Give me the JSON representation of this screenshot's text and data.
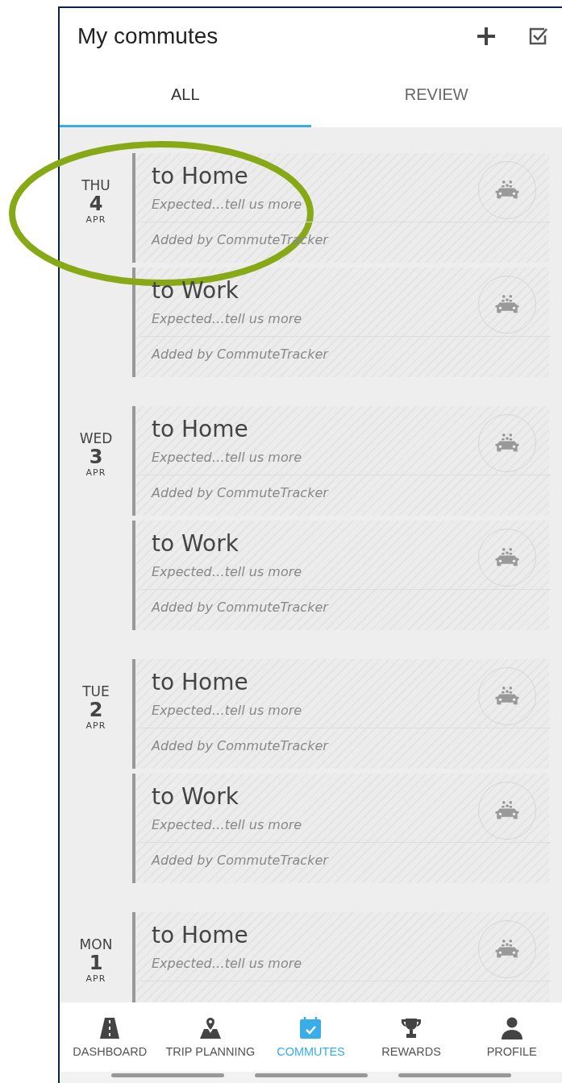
{
  "header": {
    "title": "My commutes"
  },
  "tabs": [
    {
      "label": "ALL",
      "selected": true
    },
    {
      "label": "REVIEW",
      "selected": false
    }
  ],
  "days": [
    {
      "weekday": "THU",
      "day": "4",
      "month": "APR",
      "commutes": [
        {
          "title": "to Home",
          "status": "Expected…tell us more",
          "source": "Added by CommuteTracker"
        },
        {
          "title": "to Work",
          "status": "Expected…tell us more",
          "source": "Added by CommuteTracker"
        }
      ]
    },
    {
      "weekday": "WED",
      "day": "3",
      "month": "APR",
      "commutes": [
        {
          "title": "to Home",
          "status": "Expected…tell us more",
          "source": "Added by CommuteTracker"
        },
        {
          "title": "to Work",
          "status": "Expected…tell us more",
          "source": "Added by CommuteTracker"
        }
      ]
    },
    {
      "weekday": "TUE",
      "day": "2",
      "month": "APR",
      "commutes": [
        {
          "title": "to Home",
          "status": "Expected…tell us more",
          "source": "Added by CommuteTracker"
        },
        {
          "title": "to Work",
          "status": "Expected…tell us more",
          "source": "Added by CommuteTracker"
        }
      ]
    },
    {
      "weekday": "MON",
      "day": "1",
      "month": "APR",
      "commutes": [
        {
          "title": "to Home",
          "status": "Expected…tell us more"
        }
      ]
    }
  ],
  "nav": [
    {
      "label": "DASHBOARD",
      "selected": false
    },
    {
      "label": "TRIP PLANNING",
      "selected": false
    },
    {
      "label": "COMMUTES",
      "selected": true
    },
    {
      "label": "REWARDS",
      "selected": false
    },
    {
      "label": "PROFILE",
      "selected": false
    }
  ]
}
